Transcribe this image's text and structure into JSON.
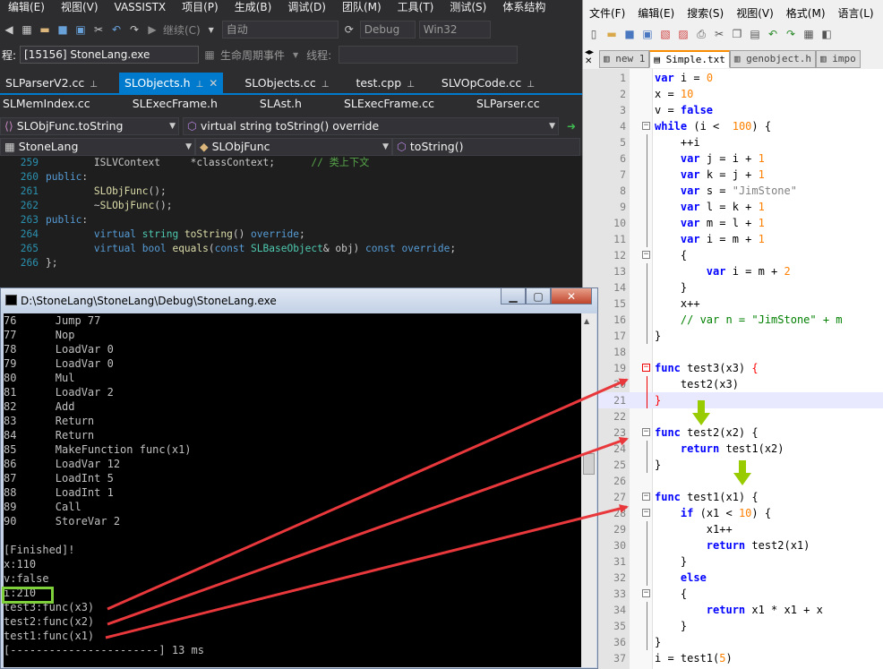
{
  "vs": {
    "menu": [
      "编辑(E)",
      "视图(V)",
      "VASSISTX",
      "项目(P)",
      "生成(B)",
      "调试(D)",
      "团队(M)",
      "工具(T)",
      "测试(S)",
      "体系结构"
    ],
    "toolbar": {
      "continue": "继续(C)",
      "auto": "自动",
      "config": "Debug",
      "platform": "Win32"
    },
    "process": {
      "label": "程:",
      "value": "[15156] StoneLang.exe",
      "lifecycle": "生命周期事件",
      "thread": "线程:"
    },
    "tabs1": [
      {
        "label": "SLParserV2.cc",
        "active": false
      },
      {
        "label": "SLObjects.h",
        "active": true
      },
      {
        "label": "SLObjects.cc",
        "active": false
      },
      {
        "label": "test.cpp",
        "active": false
      },
      {
        "label": "SLVOpCode.cc",
        "active": false
      }
    ],
    "tabs2": [
      "SLMemIndex.cc",
      "SLExecFrame.h",
      "SLAst.h",
      "SLExecFrame.cc",
      "SLParser.cc"
    ],
    "nav1": {
      "scope": "SLObjFunc.toString",
      "member": "virtual string toString() override"
    },
    "nav2": {
      "project": "StoneLang",
      "class": "SLObjFunc",
      "method": "toString()"
    },
    "code": [
      {
        "n": "259",
        "parts": [
          [
            "id",
            "        ISLVContext     *classContext;      "
          ],
          [
            "cm",
            "// 类上下文"
          ]
        ]
      },
      {
        "n": "260",
        "parts": [
          [
            "kw",
            "public"
          ],
          [
            "id",
            ":"
          ]
        ]
      },
      {
        "n": "261",
        "parts": [
          [
            "id",
            "        "
          ],
          [
            "fn",
            "SLObjFunc"
          ],
          [
            "id",
            "();"
          ]
        ]
      },
      {
        "n": "262",
        "parts": [
          [
            "id",
            "        ~"
          ],
          [
            "fn",
            "SLObjFunc"
          ],
          [
            "id",
            "();"
          ]
        ]
      },
      {
        "n": "263",
        "parts": [
          [
            "kw",
            "public"
          ],
          [
            "id",
            ":"
          ]
        ]
      },
      {
        "n": "264",
        "parts": [
          [
            "id",
            "        "
          ],
          [
            "kw",
            "virtual "
          ],
          [
            "ty",
            "string "
          ],
          [
            "fn",
            "toString"
          ],
          [
            "id",
            "() "
          ],
          [
            "kw",
            "override"
          ],
          [
            "id",
            ";"
          ]
        ]
      },
      {
        "n": "265",
        "parts": [
          [
            "id",
            "        "
          ],
          [
            "kw",
            "virtual bool "
          ],
          [
            "fn",
            "equals"
          ],
          [
            "id",
            "("
          ],
          [
            "kw",
            "const "
          ],
          [
            "ty",
            "SLBaseObject"
          ],
          [
            "id",
            "& obj) "
          ],
          [
            "kw",
            "const override"
          ],
          [
            "id",
            ";"
          ]
        ]
      },
      {
        "n": "266",
        "parts": [
          [
            "id",
            "};"
          ]
        ]
      }
    ]
  },
  "console": {
    "title": "D:\\StoneLang\\StoneLang\\Debug\\StoneLang.exe",
    "lines": [
      "76      Jump 77",
      "77      Nop",
      "78      LoadVar 0",
      "79      LoadVar 0",
      "80      Mul",
      "81      LoadVar 2",
      "82      Add",
      "83      Return",
      "84      Return",
      "85      MakeFunction func(x1)",
      "86      LoadVar 12",
      "87      LoadInt 5",
      "88      LoadInt 1",
      "89      Call",
      "90      StoreVar 2",
      "",
      "[Finished]!",
      "x:110",
      "v:false",
      "i:210",
      "test3:func(x3)",
      "test2:func(x2)",
      "test1:func(x1)",
      "[-----------------------] 13 ms"
    ]
  },
  "npp": {
    "menu": [
      "文件(F)",
      "编辑(E)",
      "搜索(S)",
      "视图(V)",
      "格式(M)",
      "语言(L)",
      "设"
    ],
    "tabs": [
      {
        "label": "new 1",
        "active": false
      },
      {
        "label": "Simple.txt",
        "active": true
      },
      {
        "label": "genobject.h",
        "active": false
      },
      {
        "label": "impo",
        "active": false
      }
    ],
    "lines": [
      {
        "n": "1",
        "parts": [
          [
            "k",
            "var "
          ],
          [
            "t",
            "i = "
          ],
          [
            "u",
            "0"
          ]
        ]
      },
      {
        "n": "2",
        "parts": [
          [
            "t",
            "x = "
          ],
          [
            "u",
            "10"
          ]
        ]
      },
      {
        "n": "3",
        "parts": [
          [
            "t",
            "v = "
          ],
          [
            "k",
            "false"
          ]
        ]
      },
      {
        "n": "4",
        "parts": [
          [
            "k",
            "while "
          ],
          [
            "t",
            "(i <  "
          ],
          [
            "u",
            "100"
          ],
          [
            "t",
            ") {"
          ]
        ]
      },
      {
        "n": "5",
        "parts": [
          [
            "t",
            "    ++i"
          ]
        ]
      },
      {
        "n": "6",
        "parts": [
          [
            "t",
            "    "
          ],
          [
            "k",
            "var "
          ],
          [
            "t",
            "j = i + "
          ],
          [
            "u",
            "1"
          ]
        ]
      },
      {
        "n": "7",
        "parts": [
          [
            "t",
            "    "
          ],
          [
            "k",
            "var "
          ],
          [
            "t",
            "k = j + "
          ],
          [
            "u",
            "1"
          ]
        ]
      },
      {
        "n": "8",
        "parts": [
          [
            "t",
            "    "
          ],
          [
            "k",
            "var "
          ],
          [
            "t",
            "s = "
          ],
          [
            "s",
            "\"JimStone\""
          ]
        ]
      },
      {
        "n": "9",
        "parts": [
          [
            "t",
            "    "
          ],
          [
            "k",
            "var "
          ],
          [
            "t",
            "l = k + "
          ],
          [
            "u",
            "1"
          ]
        ]
      },
      {
        "n": "10",
        "parts": [
          [
            "t",
            "    "
          ],
          [
            "k",
            "var "
          ],
          [
            "t",
            "m = l + "
          ],
          [
            "u",
            "1"
          ]
        ]
      },
      {
        "n": "11",
        "parts": [
          [
            "t",
            "    "
          ],
          [
            "k",
            "var "
          ],
          [
            "t",
            "i = m + "
          ],
          [
            "u",
            "1"
          ]
        ]
      },
      {
        "n": "12",
        "parts": [
          [
            "t",
            "    {"
          ]
        ]
      },
      {
        "n": "13",
        "parts": [
          [
            "t",
            "        "
          ],
          [
            "k",
            "var "
          ],
          [
            "t",
            "i = m + "
          ],
          [
            "u",
            "2"
          ]
        ]
      },
      {
        "n": "14",
        "parts": [
          [
            "t",
            "    }"
          ]
        ]
      },
      {
        "n": "15",
        "parts": [
          [
            "t",
            "    x++"
          ]
        ]
      },
      {
        "n": "16",
        "parts": [
          [
            "t",
            "    "
          ],
          [
            "c",
            "// var n = \"JimStone\" + m"
          ]
        ]
      },
      {
        "n": "17",
        "parts": [
          [
            "t",
            "}"
          ]
        ]
      },
      {
        "n": "18",
        "parts": []
      },
      {
        "n": "19",
        "parts": [
          [
            "k",
            "func "
          ],
          [
            "t",
            "test3(x3) "
          ],
          [
            "r",
            "{"
          ]
        ]
      },
      {
        "n": "20",
        "parts": [
          [
            "t",
            "    test2(x3)"
          ]
        ]
      },
      {
        "n": "21",
        "parts": [
          [
            "r",
            "}"
          ]
        ]
      },
      {
        "n": "22",
        "parts": []
      },
      {
        "n": "23",
        "parts": [
          [
            "k",
            "func "
          ],
          [
            "t",
            "test2(x2) {"
          ]
        ]
      },
      {
        "n": "24",
        "parts": [
          [
            "t",
            "    "
          ],
          [
            "k",
            "return "
          ],
          [
            "t",
            "test1(x2)"
          ]
        ]
      },
      {
        "n": "25",
        "parts": [
          [
            "t",
            "}"
          ]
        ]
      },
      {
        "n": "26",
        "parts": []
      },
      {
        "n": "27",
        "parts": [
          [
            "k",
            "func "
          ],
          [
            "t",
            "test1(x1) {"
          ]
        ]
      },
      {
        "n": "28",
        "parts": [
          [
            "t",
            "    "
          ],
          [
            "k",
            "if "
          ],
          [
            "t",
            "(x1 < "
          ],
          [
            "u",
            "10"
          ],
          [
            "t",
            ") {"
          ]
        ]
      },
      {
        "n": "29",
        "parts": [
          [
            "t",
            "        x1++"
          ]
        ]
      },
      {
        "n": "30",
        "parts": [
          [
            "t",
            "        "
          ],
          [
            "k",
            "return "
          ],
          [
            "t",
            "test2(x1)"
          ]
        ]
      },
      {
        "n": "31",
        "parts": [
          [
            "t",
            "    }"
          ]
        ]
      },
      {
        "n": "32",
        "parts": [
          [
            "t",
            "    "
          ],
          [
            "k",
            "else"
          ]
        ]
      },
      {
        "n": "33",
        "parts": [
          [
            "t",
            "    {"
          ]
        ]
      },
      {
        "n": "34",
        "parts": [
          [
            "t",
            "        "
          ],
          [
            "k",
            "return "
          ],
          [
            "t",
            "x1 * x1 + x"
          ]
        ]
      },
      {
        "n": "35",
        "parts": [
          [
            "t",
            "    }"
          ]
        ]
      },
      {
        "n": "36",
        "parts": [
          [
            "t",
            "}"
          ]
        ]
      },
      {
        "n": "37",
        "parts": [
          [
            "t",
            "i = test1("
          ],
          [
            "u",
            "5"
          ],
          [
            "t",
            ")"
          ]
        ]
      }
    ]
  },
  "colors": {
    "vs_bg": "#2d2d30",
    "vs_accent": "#007acc",
    "arrow_red": "#e8383c",
    "arrow_green": "#99cc00",
    "highlight_box": "#7fd13b"
  }
}
